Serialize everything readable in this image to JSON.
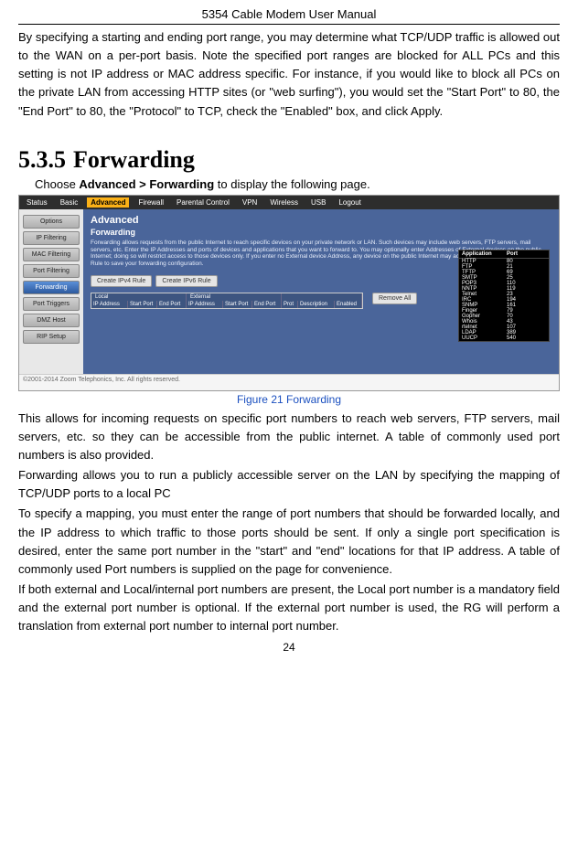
{
  "header": {
    "title": "5354 Cable Modem User Manual"
  },
  "intro_para": "By specifying a starting and ending port range, you may determine what TCP/UDP traffic is allowed out to the WAN on a per-port basis.    Note the specified port ranges are blocked for ALL PCs and this setting is not IP address or MAC address specific. For instance, if you would like to block all PCs on the private LAN from accessing HTTP sites (or \"web surfing\"), you would set the \"Start Port\" to 80, the \"End Port\" to 80, the \"Protocol\" to TCP, check the \"Enabled\" box, and click Apply.",
  "section": {
    "number": "5.3.5",
    "title": "Forwarding",
    "choose_prefix": "Choose ",
    "choose_bold": "Advanced > Forwarding",
    "choose_suffix": " to display the following page."
  },
  "screenshot": {
    "topnav": {
      "items": [
        "Status",
        "Basic",
        "Advanced",
        "Firewall",
        "Parental Control",
        "VPN",
        "Wireless",
        "USB",
        "Logout"
      ],
      "active": "Advanced"
    },
    "leftnav": {
      "items": [
        "Options",
        "IP Filtering",
        "MAC Filtering",
        "Port Filtering",
        "Forwarding",
        "Port Triggers",
        "DMZ Host",
        "RIP Setup"
      ],
      "selected": "Forwarding"
    },
    "page": {
      "h1": "Advanced",
      "h2": "Forwarding",
      "desc": "Forwarding allows requests from the public Internet to reach specific devices on your private network or LAN. Such devices may include web servers, FTP servers, mail servers, etc. Enter the IP Addresses and ports of devices and applications that you want to forward to. You may optionally enter Addresses of External devices on the public Internet; doing so will restrict access to those devices only. If you enter no External device Address, any device on the public Internet may access your devices. Click Create Rule to save your forwarding configuration.",
      "btn_ipv4": "Create IPv4 Rule",
      "btn_ipv6": "Create IPv6 Rule",
      "grid": {
        "section_local": "Local",
        "section_external": "External",
        "cols": [
          "IP Address",
          "Start Port",
          "End Port",
          "IP Address",
          "Start Port",
          "End Port",
          "Prot",
          "Description",
          "Enabled"
        ]
      },
      "remove_all": "Remove All"
    },
    "port_table": {
      "head": [
        "Application",
        "Port"
      ],
      "rows": [
        [
          "HTTP",
          "80"
        ],
        [
          "FTP",
          "21"
        ],
        [
          "TFTP",
          "69"
        ],
        [
          "SMTP",
          "25"
        ],
        [
          "POP3",
          "110"
        ],
        [
          "NNTP",
          "119"
        ],
        [
          "Telnet",
          "23"
        ],
        [
          "IRC",
          "194"
        ],
        [
          "SNMP",
          "161"
        ],
        [
          "Finger",
          "79"
        ],
        [
          "Gopher",
          "70"
        ],
        [
          "Whois",
          "43"
        ],
        [
          "rtelnet",
          "107"
        ],
        [
          "LDAP",
          "389"
        ],
        [
          "UUCP",
          "540"
        ]
      ]
    },
    "copyright": "©2001-2014 Zoom Telephonics, Inc. All rights reserved."
  },
  "figure_caption": "Figure 21 Forwarding",
  "body_paras": {
    "p1": "This allows for incoming requests on specific port numbers to reach web servers, FTP servers, mail servers, etc. so they can be accessible from the public internet. A table of commonly used port numbers is also provided.",
    "p2": "Forwarding allows you to run a publicly accessible server on the LAN by specifying the mapping of TCP/UDP ports to a local PC",
    "p3": "To specify a mapping, you must enter the range of port numbers that should be forwarded locally, and the IP address to which traffic to those ports should be sent.    If only a single port specification is desired, enter the same port number in the \"start\" and \"end\" locations for that IP address.    A table of commonly used Port numbers is supplied on the page for convenience.",
    "p4": "If both external and Local/internal port numbers are present, the Local port number is a mandatory field and the external port number is optional.  If the external port number is used, the RG will perform a translation from external port number to internal port number."
  },
  "page_number": "24"
}
